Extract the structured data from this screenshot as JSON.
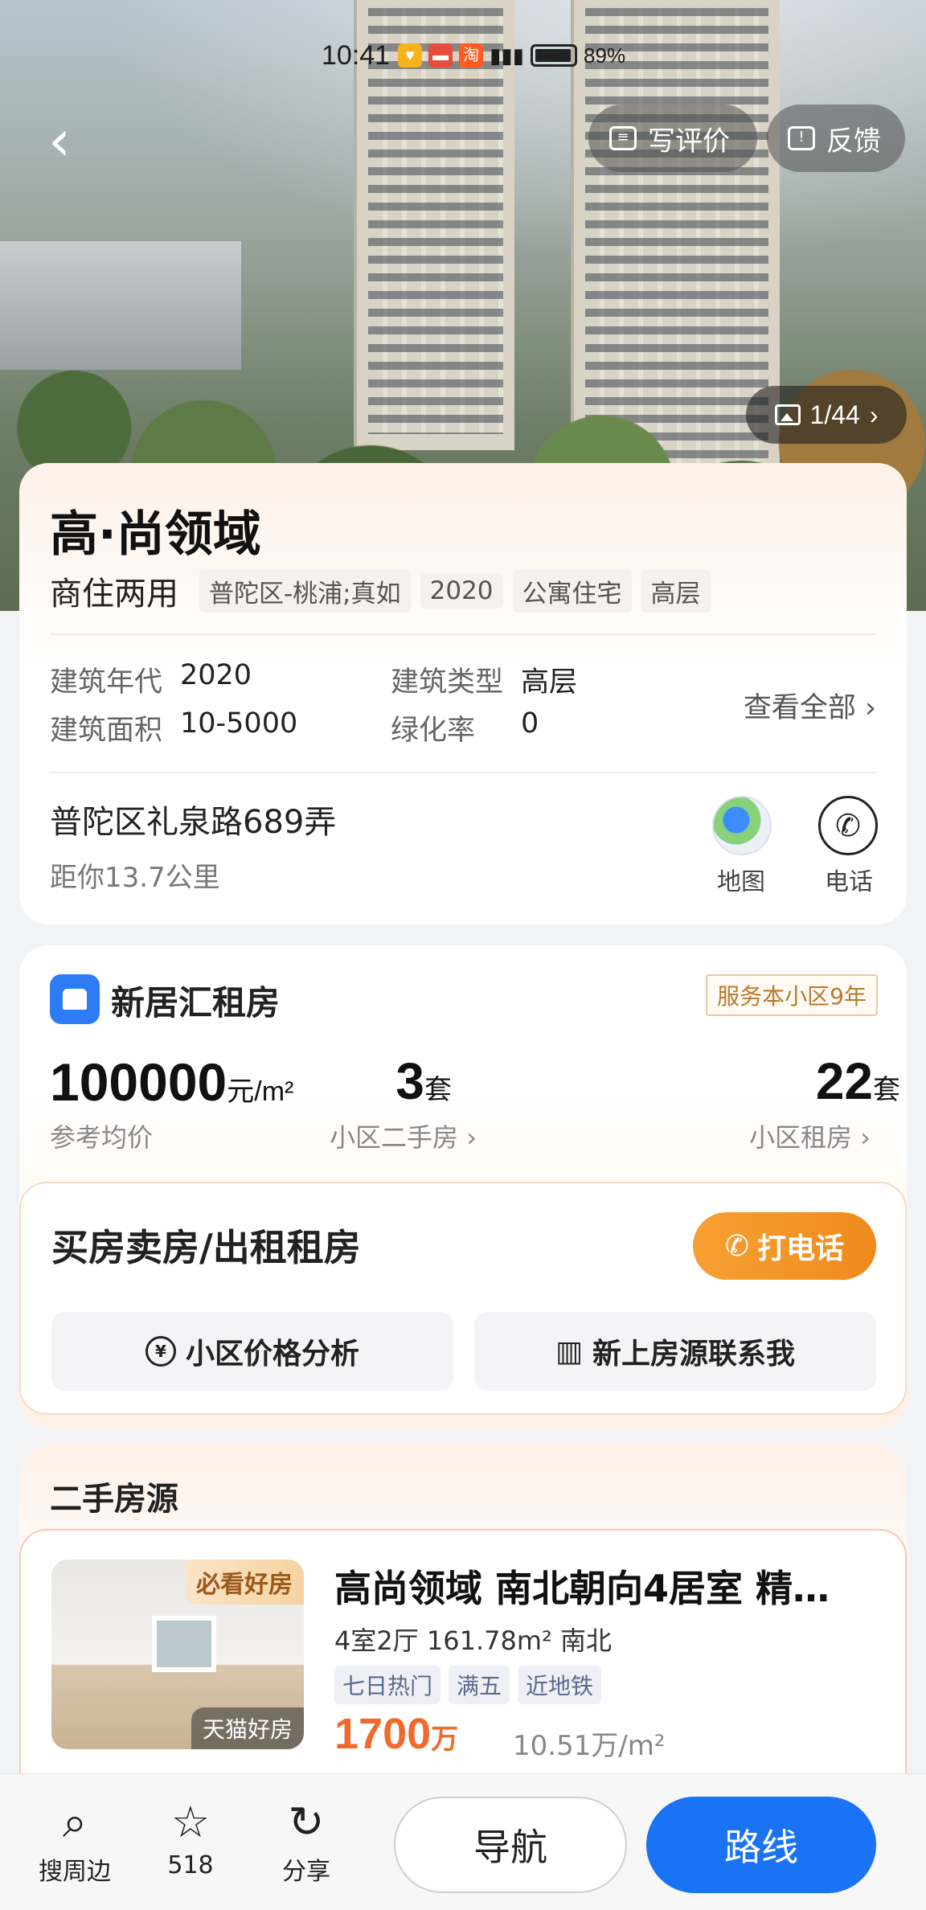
{
  "status_bar": {
    "time": "10:41",
    "battery": "89%"
  },
  "header": {
    "back_label": "‹",
    "review_label": "写评价",
    "feedback_label": "反馈",
    "photo_counter": "1/44"
  },
  "community": {
    "name": "高·尚领域",
    "usage": "商住两用",
    "tags": [
      "普陀区-桃浦;真如",
      "2020",
      "公寓住宅",
      "高层"
    ],
    "specs": {
      "build_year_label": "建筑年代",
      "build_year": "2020",
      "build_type_label": "建筑类型",
      "build_type": "高层",
      "area_label": "建筑面积",
      "area": "10-5000",
      "green_label": "绿化率",
      "green": "0"
    },
    "view_all": "查看全部",
    "address": "普陀区礼泉路689弄",
    "distance": "距你13.7公里",
    "map_label": "地图",
    "phone_label": "电话"
  },
  "rental": {
    "brand": "新居汇租房",
    "service_badge": "服务本小区9年",
    "price": "100000",
    "price_unit": "元/m²",
    "price_label": "参考均价",
    "second_hand_count": "3",
    "second_hand_unit": "套",
    "second_hand_label": "小区二手房",
    "rent_count": "22",
    "rent_unit": "套",
    "rent_label": "小区租房"
  },
  "buy_sell": {
    "title": "买房卖房/出租租房",
    "call_label": "打电话",
    "price_analysis": "小区价格分析",
    "new_listing": "新上房源联系我"
  },
  "listings": {
    "section_title": "二手房源",
    "items": [
      {
        "badge_top": "必看好房",
        "badge_bottom": "天猫好房",
        "title": "高尚领域 南北朝向4居室 精…",
        "meta": "4室2厅  161.78m²  南北",
        "tags": [
          "七日热门",
          "满五",
          "近地铁"
        ],
        "price": "1700",
        "price_unit": "万",
        "unit_price": "10.51万/m²"
      }
    ]
  },
  "bottom_bar": {
    "search_label": "搜周边",
    "favorite_count": "518",
    "share_label": "分享",
    "nav_label": "导航",
    "route_label": "路线"
  },
  "colors": {
    "accent_orange": "#f08a1c",
    "price_red": "#f26a2b",
    "route_blue": "#1a73f5",
    "brand_blue": "#2d7cf6"
  }
}
